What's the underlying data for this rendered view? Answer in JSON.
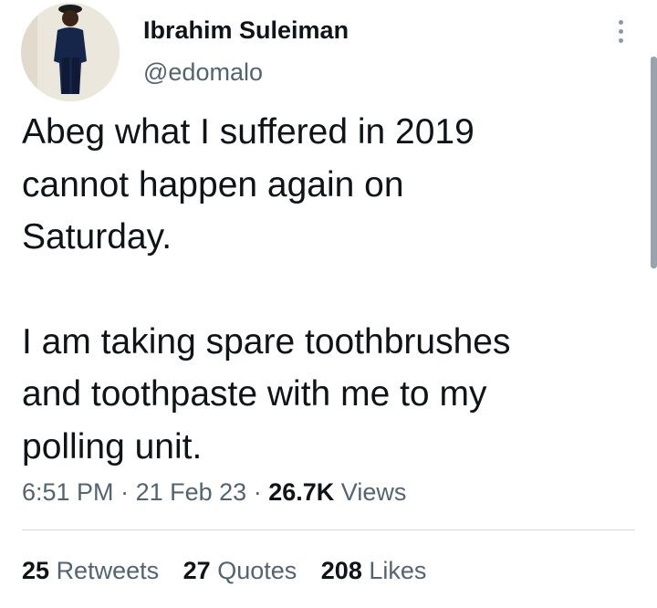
{
  "author": {
    "display_name": "Ibrahim Suleiman",
    "handle": "@edomalo"
  },
  "tweet": {
    "paragraph_1": [
      "Abeg what I suffered in 2019",
      "cannot happen again on",
      "Saturday."
    ],
    "paragraph_2": [
      "I am taking spare toothbrushes",
      "and toothpaste with me to my",
      "polling unit."
    ]
  },
  "meta": {
    "time": "6:51 PM",
    "separator": "·",
    "date": "21 Feb 23",
    "views_count": "26.7K",
    "views_label": "Views"
  },
  "stats": {
    "retweets_count": "25",
    "retweets_label": "Retweets",
    "quotes_count": "27",
    "quotes_label": "Quotes",
    "likes_count": "208",
    "likes_label": "Likes"
  },
  "icons": {
    "more": "more-vertical-icon"
  },
  "colors": {
    "text": "#0f1419",
    "secondary": "#536471",
    "divider": "#d6dbe0"
  }
}
